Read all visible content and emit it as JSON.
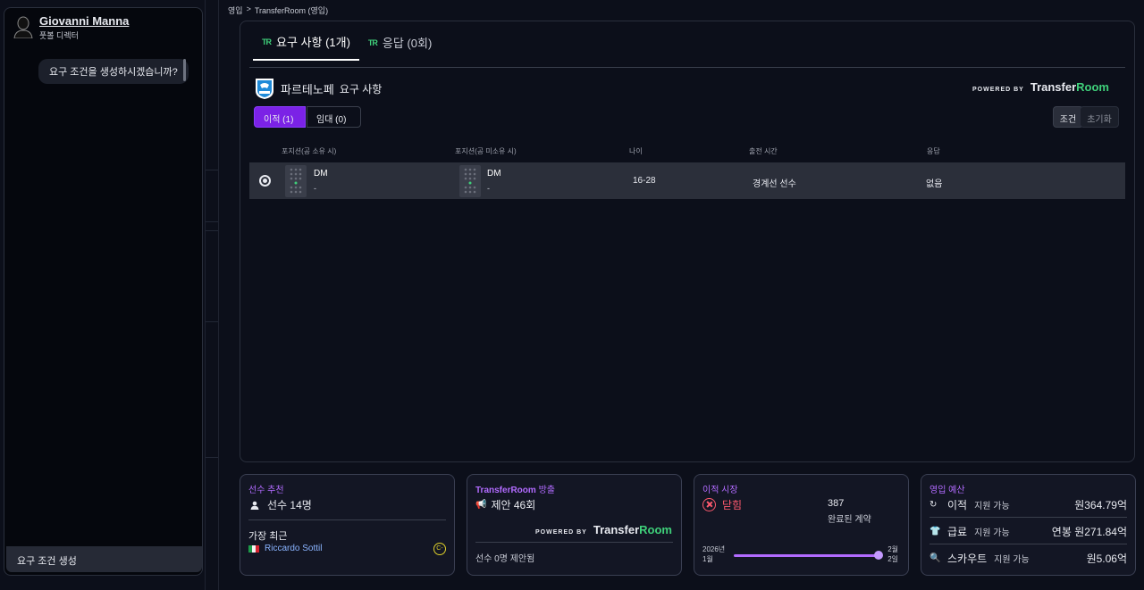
{
  "director": {
    "name": "Giovanni Manna",
    "role": "풋볼 디렉터"
  },
  "chat": {
    "question": "요구 조건을 생성하시겠습니까?",
    "generate_label": "요구 조건 생성"
  },
  "breadcrumb": [
    "영입",
    ">",
    "TransferRoom (영입)"
  ],
  "tabs": [
    {
      "mark": "TR",
      "label": "요구 사항 (1개)",
      "active": true
    },
    {
      "mark": "TR",
      "label": "응답 (0회)",
      "active": false
    }
  ],
  "club": {
    "name": "파르테노페",
    "subtitle": "요구 사항"
  },
  "powered": {
    "by": "POWERED BY",
    "brand_a": "Transfer",
    "brand_b": "Room"
  },
  "segments": {
    "transfer": "이적 (1)",
    "loan": "임대 (0)"
  },
  "filters": {
    "conditions": "조건",
    "reset": "초기화"
  },
  "table": {
    "headers": {
      "pos_in": "포지션(공 소유 시)",
      "pos_out": "포지션(공 미소유 시)",
      "age": "나이",
      "minutes": "출전 시간",
      "response": "응답"
    },
    "row": {
      "pos_in": "DM",
      "pos_in_sub": "-",
      "pos_out": "DM",
      "pos_out_sub": "-",
      "age": "16-28",
      "minutes": "경계선 선수",
      "response": "없음"
    }
  },
  "cards": {
    "recommend": {
      "title": "선수 추천",
      "count": "선수 14명",
      "recent_label": "가장 최근",
      "recent_player": "Riccardo Sottil",
      "badge": "C-"
    },
    "exposure": {
      "title_a": "TransferRoom",
      "title_b": " 방출",
      "offers": "제안 46회",
      "rejected": "선수 0명 제안됨"
    },
    "market": {
      "title": "이적 시장",
      "status": "닫힘",
      "deals_count": "387",
      "deals_label": "완료된 계약",
      "start_year": "2026년",
      "start_month": "1월",
      "end_a": "2월",
      "end_b": "2일"
    },
    "budget": {
      "title": "영입 예산",
      "rows": [
        {
          "icon": "↻",
          "label": "이적",
          "avail": "지원 가능",
          "value": "원364.79억"
        },
        {
          "icon": "👕",
          "label": "급료",
          "avail": "지원 가능",
          "value": "연봉 원271.84억"
        },
        {
          "icon": "🔍",
          "label": "스카우트",
          "avail": "지원 가능",
          "value": "원5.06억"
        }
      ]
    }
  },
  "colors": {
    "accent": "#7b22e6",
    "brand_green": "#3fd07a",
    "closed_red": "#ff5a6e",
    "title_purple": "#b26bff"
  }
}
